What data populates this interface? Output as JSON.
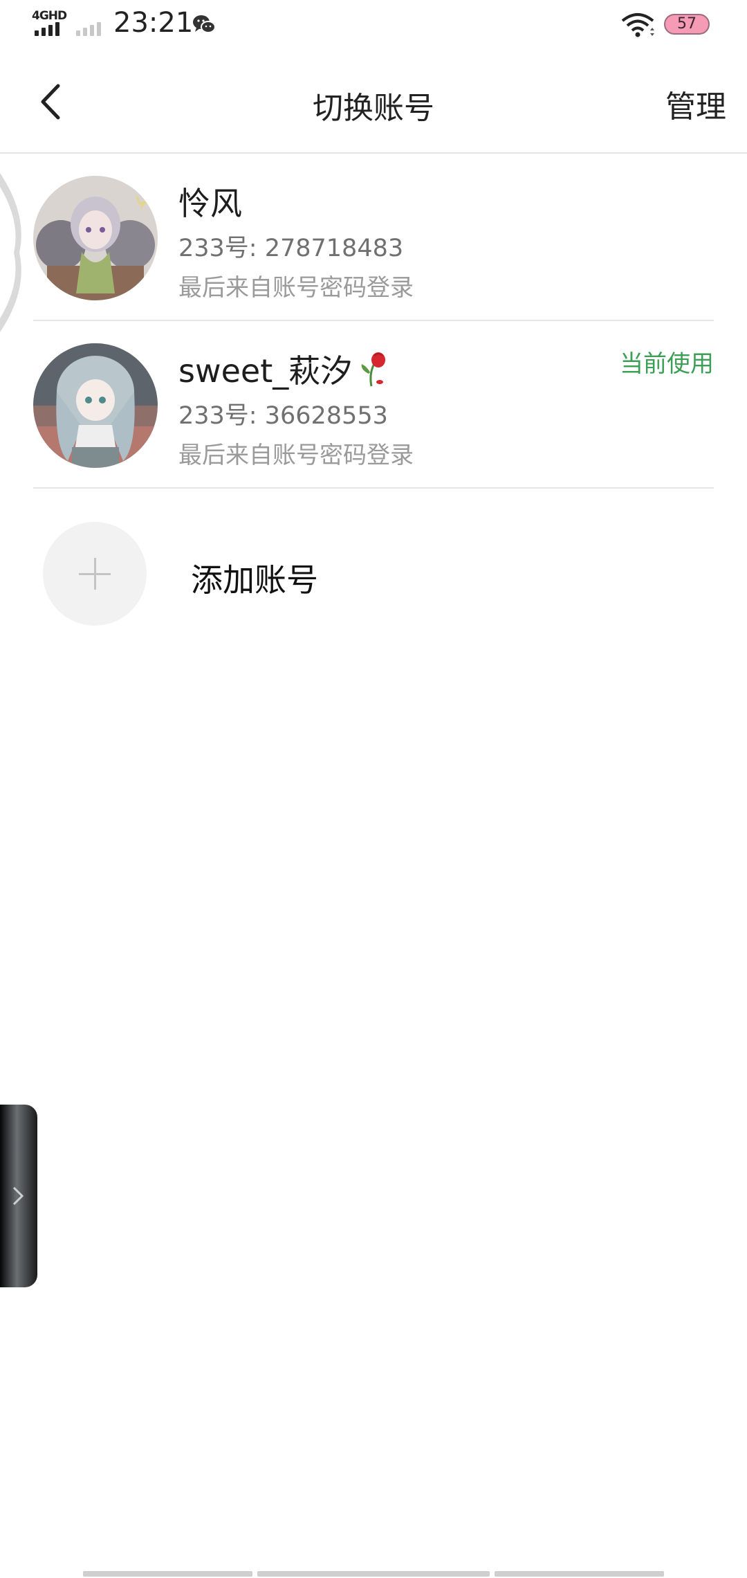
{
  "status_bar": {
    "network_type": "4GHD",
    "time": "23:21",
    "battery": "57",
    "icons": [
      "signal-icon",
      "wechat-icon",
      "wifi-icon",
      "battery-icon"
    ]
  },
  "nav": {
    "title": "切换账号",
    "manage_label": "管理",
    "back_icon": "chevron-left-icon"
  },
  "accounts": [
    {
      "name": "怜风",
      "id_text": "233号: 278718483",
      "login_method": "最后来自账号密码登录",
      "current": false,
      "avatar_icon": "avatar-anime-boy"
    },
    {
      "name": "sweet_萩汐",
      "name_emoji": "wilted-rose-icon",
      "id_text": "233号: 36628553",
      "login_method": "最后来自账号密码登录",
      "current": true,
      "current_label": "当前使用",
      "avatar_icon": "avatar-anime-girl"
    }
  ],
  "add_account": {
    "label": "添加账号",
    "icon": "plus-icon"
  },
  "colors": {
    "accent_green": "#3c9f55",
    "divider": "#e5e5e5",
    "battery_fill": "#f59bb6"
  }
}
